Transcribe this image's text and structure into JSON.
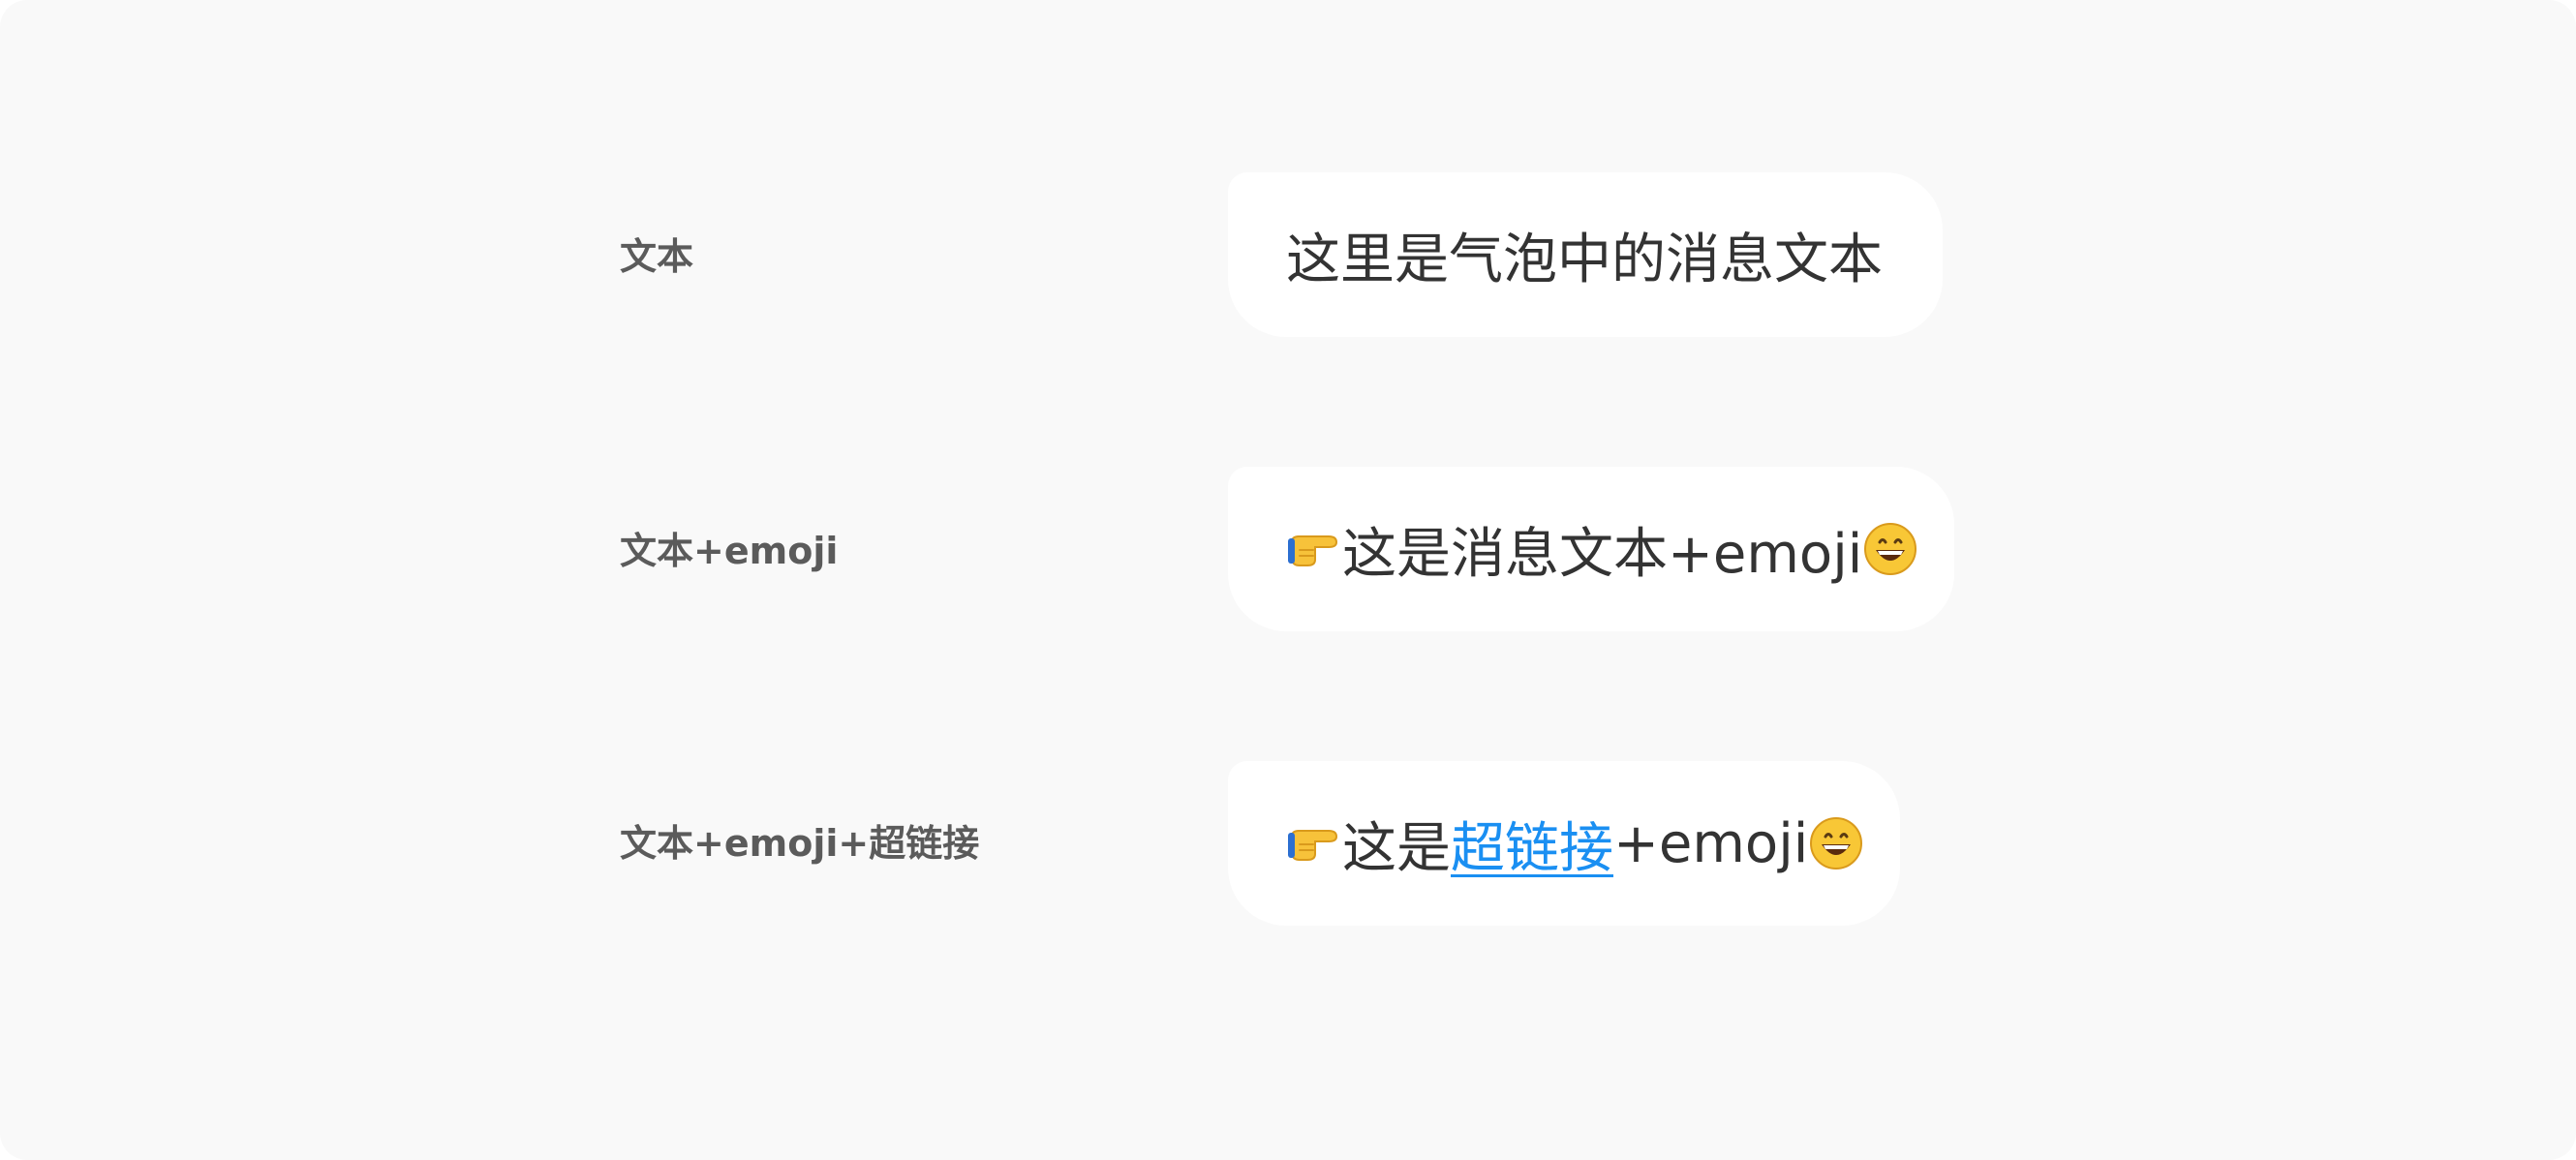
{
  "rows": [
    {
      "label": "文本",
      "bubble": {
        "text": "这里是气泡中的消息文本"
      }
    },
    {
      "label": "文本+emoji",
      "bubble": {
        "leading_emoji": "pointing-right-emoji",
        "text": "这是消息文本+emoji",
        "trailing_emoji": "grinning-face-emoji"
      }
    },
    {
      "label": "文本+emoji+超链接",
      "bubble": {
        "leading_emoji": "pointing-right-emoji",
        "text_before_link": "这是",
        "link_text": "超链接",
        "text_after_link": "+emoji",
        "trailing_emoji": "grinning-face-emoji"
      }
    }
  ],
  "colors": {
    "background": "#f9f9f9",
    "bubble": "#ffffff",
    "label_text": "#5b5b5b",
    "bubble_text": "#333333",
    "link": "#1a8ff2"
  }
}
